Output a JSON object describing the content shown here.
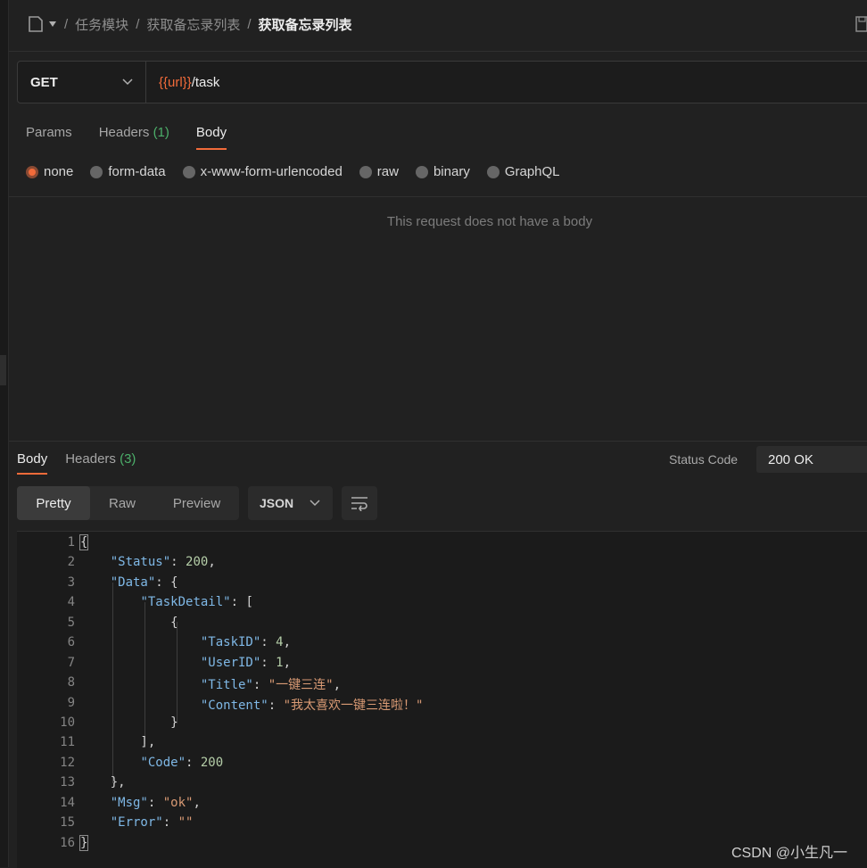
{
  "breadcrumb": {
    "items": [
      "任务模块",
      "获取备忘录列表"
    ],
    "current": "获取备忘录列表",
    "separator": "/"
  },
  "request": {
    "method": "GET",
    "url_var": "{{url}}",
    "url_path": "/task",
    "tabs": [
      {
        "label": "Params"
      },
      {
        "label": "Headers",
        "count": "(1)"
      },
      {
        "label": "Body",
        "active": true
      }
    ],
    "body_types": [
      "none",
      "form-data",
      "x-www-form-urlencoded",
      "raw",
      "binary",
      "GraphQL"
    ],
    "selected_body_type": "none",
    "empty_message": "This request does not have a body"
  },
  "response": {
    "tabs": [
      {
        "label": "Body",
        "active": true
      },
      {
        "label": "Headers",
        "count": "(3)"
      }
    ],
    "status_label": "Status Code",
    "status_value": "200 OK",
    "views": [
      "Pretty",
      "Raw",
      "Preview"
    ],
    "selected_view": "Pretty",
    "format": "JSON",
    "line_numbers": [
      "1",
      "2",
      "3",
      "4",
      "5",
      "6",
      "7",
      "8",
      "9",
      "10",
      "11",
      "12",
      "13",
      "14",
      "15",
      "16"
    ],
    "code_lines": [
      "{",
      "    \"Status\": 200,",
      "    \"Data\": {",
      "        \"TaskDetail\": [",
      "            {",
      "                \"TaskID\": 4,",
      "                \"UserID\": 1,",
      "                \"Title\": \"一键三连\",",
      "                \"Content\": \"我太喜欢一键三连啦！\"",
      "            }",
      "        ],",
      "        \"Code\": 200",
      "    },",
      "    \"Msg\": \"ok\",",
      "    \"Error\": \"\"",
      "}"
    ]
  },
  "watermark": "CSDN @小生凡一",
  "colors": {
    "accent": "#f26b3a",
    "count_green": "#4caf6a",
    "json_key": "#7fb8e6",
    "json_number": "#b5cea8",
    "json_string": "#d99a74"
  }
}
